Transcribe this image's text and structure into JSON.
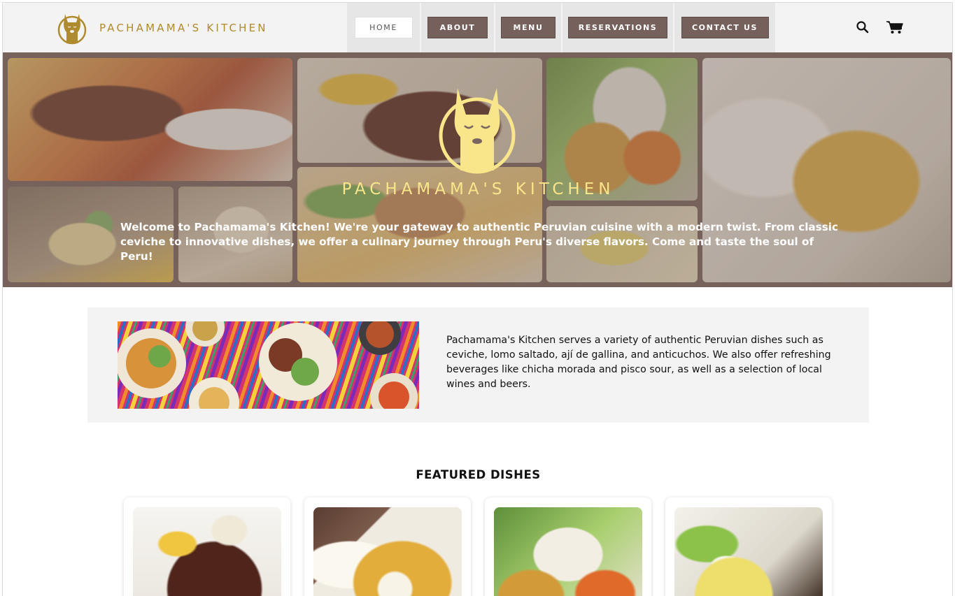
{
  "brand": {
    "name": "PACHAMAMA'S KITCHEN",
    "logo_icon": "llama-logo-icon",
    "color": "#b08a2e"
  },
  "nav": {
    "items": [
      {
        "label": "HOME",
        "active": true
      },
      {
        "label": "ABOUT",
        "active": false
      },
      {
        "label": "MENU",
        "active": false
      },
      {
        "label": "RESERVATIONS",
        "active": false
      },
      {
        "label": "CONTACT US",
        "active": false
      }
    ],
    "button_color": "#76605b",
    "cell_color": "#e6e6e6"
  },
  "header_icons": {
    "search": "search-icon",
    "cart": "cart-icon"
  },
  "hero": {
    "title": "PACHAMAMA'S KITCHEN",
    "text": "Welcome to Pachamama's Kitchen! We're your gateway to authentic Peruvian cuisine with a modern twist. From classic ceviche to innovative dishes, we offer a culinary journey through Peru's diverse flavors. Come and taste the soul of Peru!",
    "title_color": "#f9e58a",
    "overlay_color": "#705c56"
  },
  "intro": {
    "text": "Pachamama's Kitchen serves a variety of authentic Peruvian dishes such as ceviche, lomo saltado, ají de gallina, and anticuchos. We also offer refreshing beverages like chicha morada and pisco sour, as well as a selection of local wines and beers.",
    "background": "#f3f3f3"
  },
  "featured": {
    "title": "FEATURED DISHES"
  }
}
